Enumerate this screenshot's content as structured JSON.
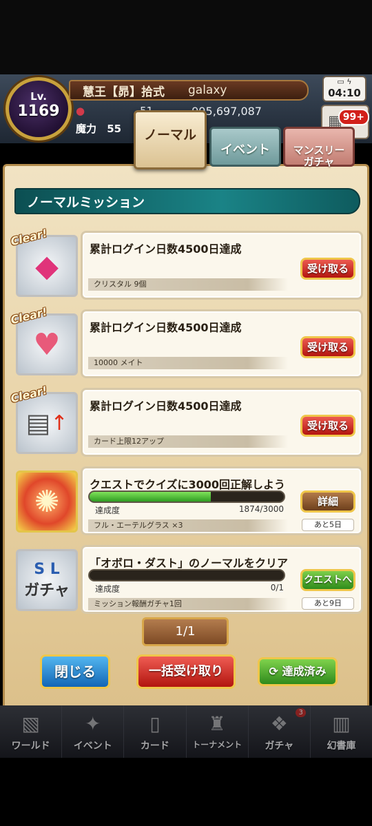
{
  "header": {
    "level_label": "Lv.",
    "level": "1169",
    "player_title": "慧王【昴】拾式",
    "player_name": "galaxy",
    "stat_small": "51",
    "gold": "995,697,087",
    "magic_label": "魔力",
    "magic_value": "55",
    "clock": "04:10",
    "notice_badge": "99+"
  },
  "tabs": {
    "normal": "ノーマル",
    "event": "イベント",
    "monthly_gacha": "マンスリー\nガチャ"
  },
  "panel": {
    "title": "ノーマルミッション"
  },
  "clear_label": "Clear!",
  "missions": [
    {
      "title": "累計ログイン日数4500日達成",
      "reward": "クリスタル 9個",
      "button": "受け取る",
      "icon": "crystal-icon",
      "cleared": true
    },
    {
      "title": "累計ログイン日数4500日達成",
      "reward": "10000 メイト",
      "button": "受け取る",
      "icon": "heart-handshake-icon",
      "cleared": true
    },
    {
      "title": "累計ログイン日数4500日達成",
      "reward": "カード上限12アップ",
      "button": "受け取る",
      "icon": "card-limit-up-icon",
      "cleared": true
    },
    {
      "title": "クエストでクイズに3000回正解しよう",
      "progress_label": "達成度",
      "progress_current": 1874,
      "progress_total": 3000,
      "progress_text": "1874/3000",
      "reward": "フル・エーテルグラス ×3",
      "button": "詳細",
      "days_left": "あと5日",
      "icon": "ether-glass-icon",
      "cleared": false
    },
    {
      "title": "「オボロ・ダスト」のノーマルをクリア",
      "progress_label": "達成度",
      "progress_current": 0,
      "progress_total": 1,
      "progress_text": "0/1",
      "reward": "ミッション報酬ガチャ1回",
      "button": "クエストへ",
      "days_left": "あと9日",
      "icon": "gacha-ticket-icon",
      "cleared": false
    }
  ],
  "pager": "1/1",
  "buttons": {
    "close": "閉じる",
    "claim_all": "一括受け取り",
    "completed": "達成済み"
  },
  "nav": [
    {
      "label": "ワールド",
      "icon": "map-icon"
    },
    {
      "label": "イベント",
      "icon": "event-icon"
    },
    {
      "label": "カード",
      "icon": "card-icon"
    },
    {
      "label": "トーナメント",
      "icon": "trophy-icon"
    },
    {
      "label": "ガチャ",
      "icon": "gacha-icon",
      "badge": "3"
    },
    {
      "label": "幻書庫",
      "icon": "library-icon"
    }
  ],
  "colors": {
    "claim_button": "#b4150f",
    "progress_fill": "#2f9d22",
    "panel_header": "#1a8386"
  }
}
